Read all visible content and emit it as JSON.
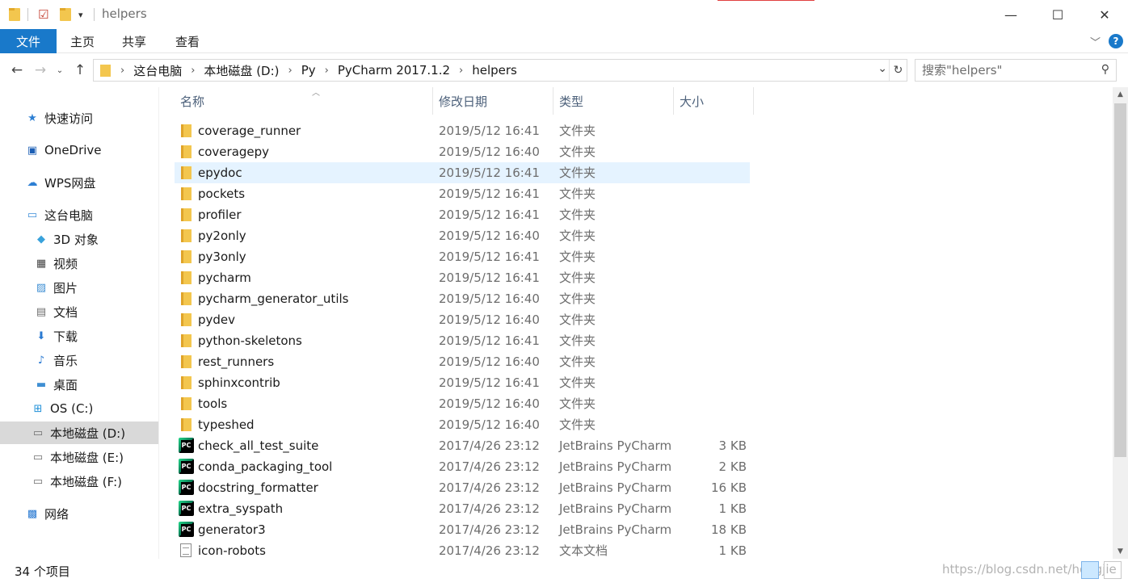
{
  "window": {
    "title": "helpers",
    "controls": {
      "minimize": "—",
      "maximize": "☐",
      "close": "✕"
    }
  },
  "ribbon": {
    "tabs": [
      {
        "label": "文件",
        "active": true
      },
      {
        "label": "主页"
      },
      {
        "label": "共享"
      },
      {
        "label": "查看"
      }
    ],
    "help": "?"
  },
  "address": {
    "crumbs": [
      "这台电脑",
      "本地磁盘 (D:)",
      "Py",
      "PyCharm 2017.1.2",
      "helpers"
    ],
    "search_placeholder": "搜索\"helpers\""
  },
  "sidebar": {
    "items": [
      {
        "label": "快速访问",
        "icon": "star-icon",
        "color": "#2d7fd3"
      },
      {
        "label": "OneDrive",
        "icon": "onedrive-icon",
        "color": "#1c5fb5"
      },
      {
        "label": "WPS网盘",
        "icon": "cloud-icon",
        "color": "#2d7fd3"
      },
      {
        "label": "这台电脑",
        "icon": "computer-icon",
        "color": "#3c8ed8"
      },
      {
        "label": "3D 对象",
        "icon": "3d-objects-icon",
        "color": "#39a2db"
      },
      {
        "label": "视频",
        "icon": "video-icon",
        "color": "#444444"
      },
      {
        "label": "图片",
        "icon": "pictures-icon",
        "color": "#3f8fd3"
      },
      {
        "label": "文档",
        "icon": "documents-icon",
        "color": "#6d6d6d"
      },
      {
        "label": "下载",
        "icon": "downloads-icon",
        "color": "#2a7ad2"
      },
      {
        "label": "音乐",
        "icon": "music-icon",
        "color": "#2a7ad2"
      },
      {
        "label": "桌面",
        "icon": "desktop-icon",
        "color": "#3f8fd3"
      },
      {
        "label": "OS (C:)",
        "icon": "windows-drive-icon",
        "color": "#1e90d8"
      },
      {
        "label": "本地磁盘 (D:)",
        "icon": "drive-icon",
        "color": "#6d6d6d",
        "selected": true
      },
      {
        "label": "本地磁盘 (E:)",
        "icon": "drive-icon",
        "color": "#6d6d6d"
      },
      {
        "label": "本地磁盘 (F:)",
        "icon": "drive-icon",
        "color": "#6d6d6d"
      },
      {
        "label": "网络",
        "icon": "network-icon",
        "color": "#2a7ad2"
      }
    ]
  },
  "list": {
    "columns": {
      "name": "名称",
      "date": "修改日期",
      "type": "类型",
      "size": "大小"
    },
    "rows": [
      {
        "name": "coverage_runner",
        "date": "2019/5/12 16:41",
        "type": "文件夹",
        "size": "",
        "kind": "folder"
      },
      {
        "name": "coveragepy",
        "date": "2019/5/12 16:40",
        "type": "文件夹",
        "size": "",
        "kind": "folder"
      },
      {
        "name": "epydoc",
        "date": "2019/5/12 16:41",
        "type": "文件夹",
        "size": "",
        "kind": "folder",
        "hover": true
      },
      {
        "name": "pockets",
        "date": "2019/5/12 16:41",
        "type": "文件夹",
        "size": "",
        "kind": "folder"
      },
      {
        "name": "profiler",
        "date": "2019/5/12 16:41",
        "type": "文件夹",
        "size": "",
        "kind": "folder"
      },
      {
        "name": "py2only",
        "date": "2019/5/12 16:40",
        "type": "文件夹",
        "size": "",
        "kind": "folder"
      },
      {
        "name": "py3only",
        "date": "2019/5/12 16:41",
        "type": "文件夹",
        "size": "",
        "kind": "folder"
      },
      {
        "name": "pycharm",
        "date": "2019/5/12 16:41",
        "type": "文件夹",
        "size": "",
        "kind": "folder"
      },
      {
        "name": "pycharm_generator_utils",
        "date": "2019/5/12 16:40",
        "type": "文件夹",
        "size": "",
        "kind": "folder"
      },
      {
        "name": "pydev",
        "date": "2019/5/12 16:40",
        "type": "文件夹",
        "size": "",
        "kind": "folder"
      },
      {
        "name": "python-skeletons",
        "date": "2019/5/12 16:41",
        "type": "文件夹",
        "size": "",
        "kind": "folder"
      },
      {
        "name": "rest_runners",
        "date": "2019/5/12 16:40",
        "type": "文件夹",
        "size": "",
        "kind": "folder"
      },
      {
        "name": "sphinxcontrib",
        "date": "2019/5/12 16:41",
        "type": "文件夹",
        "size": "",
        "kind": "folder"
      },
      {
        "name": "tools",
        "date": "2019/5/12 16:40",
        "type": "文件夹",
        "size": "",
        "kind": "folder"
      },
      {
        "name": "typeshed",
        "date": "2019/5/12 16:40",
        "type": "文件夹",
        "size": "",
        "kind": "folder"
      },
      {
        "name": "check_all_test_suite",
        "date": "2017/4/26 23:12",
        "type": "JetBrains PyCharm",
        "size": "3 KB",
        "kind": "pycharm"
      },
      {
        "name": "conda_packaging_tool",
        "date": "2017/4/26 23:12",
        "type": "JetBrains PyCharm",
        "size": "2 KB",
        "kind": "pycharm"
      },
      {
        "name": "docstring_formatter",
        "date": "2017/4/26 23:12",
        "type": "JetBrains PyCharm",
        "size": "16 KB",
        "kind": "pycharm"
      },
      {
        "name": "extra_syspath",
        "date": "2017/4/26 23:12",
        "type": "JetBrains PyCharm",
        "size": "1 KB",
        "kind": "pycharm"
      },
      {
        "name": "generator3",
        "date": "2017/4/26 23:12",
        "type": "JetBrains PyCharm",
        "size": "18 KB",
        "kind": "pycharm"
      },
      {
        "name": "icon-robots",
        "date": "2017/4/26 23:12",
        "type": "文本文档",
        "size": "1 KB",
        "kind": "text"
      }
    ]
  },
  "status": {
    "item_count": "34 个项目",
    "watermark": "https://blog.csdn.net/hongjie"
  }
}
